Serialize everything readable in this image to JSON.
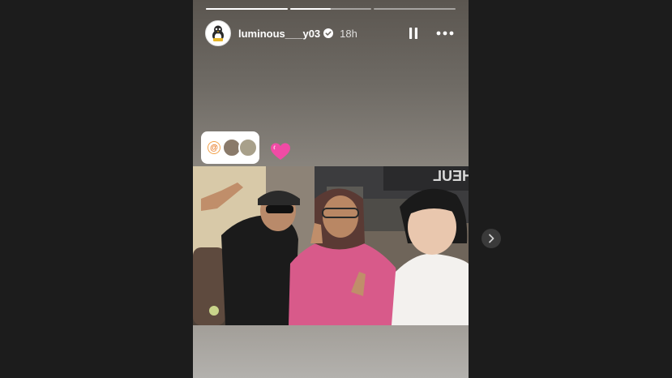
{
  "story": {
    "username": "luminous___y03",
    "time": "18h",
    "progress": [
      1,
      0.5,
      0
    ],
    "icons": {
      "verified": "verified-badge-icon",
      "pause": "pause-icon",
      "more": "more-options-icon",
      "threads": "threads-icon",
      "heart": "pink-heart-sticker",
      "next": "chevron-right-icon"
    }
  }
}
